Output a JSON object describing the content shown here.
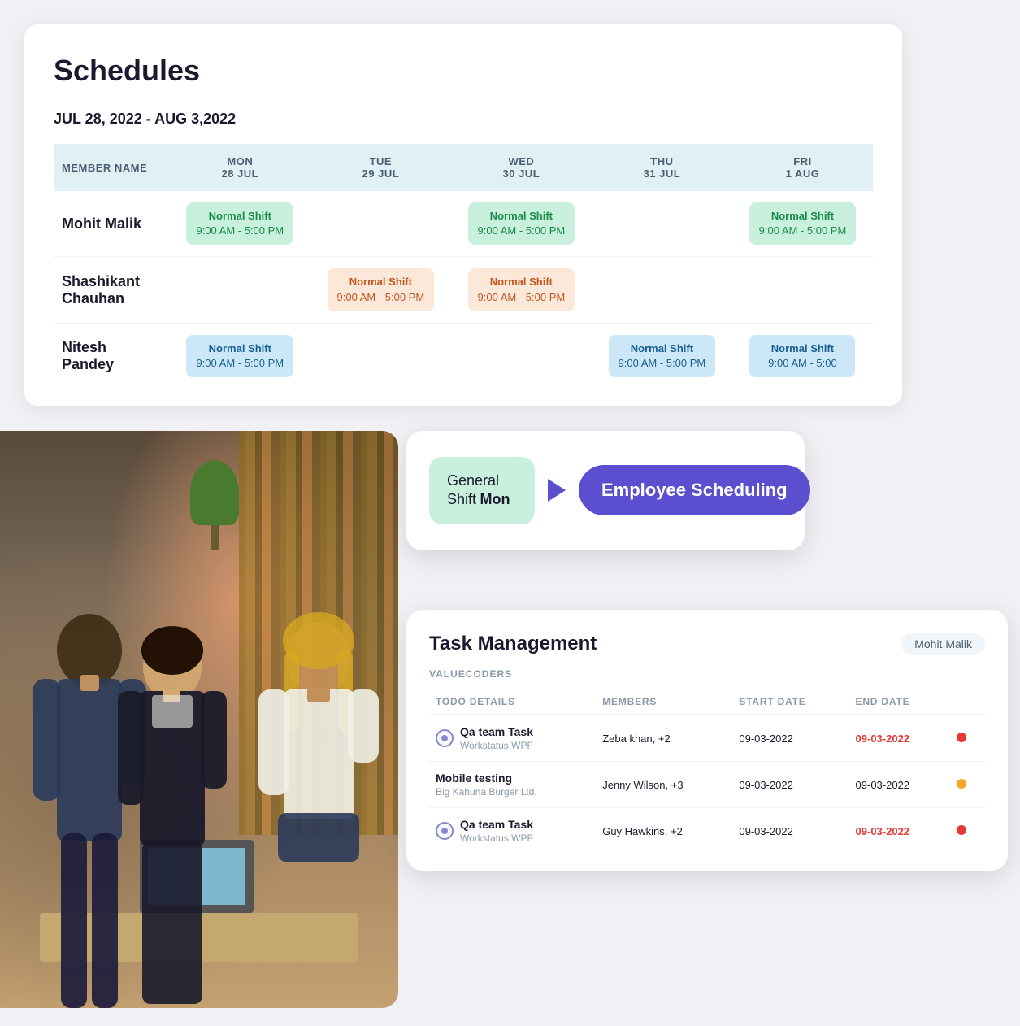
{
  "page": {
    "background": "#f0f0f5"
  },
  "schedules": {
    "title": "Schedules",
    "date_range": "JUL 28, 2022 - AUG 3,2022",
    "columns": [
      {
        "id": "name",
        "label": "MEMBER NAME",
        "sub": ""
      },
      {
        "id": "mon",
        "label": "MON",
        "sub": "28 JUL"
      },
      {
        "id": "tue",
        "label": "TUE",
        "sub": "29 JUL"
      },
      {
        "id": "wed",
        "label": "WED",
        "sub": "30 JUL"
      },
      {
        "id": "thu",
        "label": "THU",
        "sub": "31 JUL"
      },
      {
        "id": "fri",
        "label": "FRI",
        "sub": "1 AUG"
      }
    ],
    "rows": [
      {
        "name": "Mohit Malik",
        "shifts": {
          "mon": {
            "label": "Normal Shift",
            "time": "9:00 AM - 5:00 PM",
            "type": "green"
          },
          "tue": null,
          "wed": {
            "label": "Normal Shift",
            "time": "9:00 AM - 5:00 PM",
            "type": "green"
          },
          "thu": null,
          "fri": {
            "label": "Normal Shift",
            "time": "9:00 AM - 5:00 PM",
            "type": "green"
          }
        }
      },
      {
        "name": "Shashikant Chauhan",
        "shifts": {
          "mon": null,
          "tue": {
            "label": "Normal Shift",
            "time": "9:00 AM - 5:00 PM",
            "type": "peach"
          },
          "wed": {
            "label": "Normal Shift",
            "time": "9:00 AM - 5:00 PM",
            "type": "peach"
          },
          "thu": null,
          "fri": null
        }
      },
      {
        "name": "Nitesh Pandey",
        "shifts": {
          "mon": {
            "label": "Normal Shift",
            "time": "9:00 AM - 5:00 PM",
            "type": "blue"
          },
          "tue": null,
          "wed": null,
          "thu": {
            "label": "Normal Shift",
            "time": "9:00 AM - 5:00 PM",
            "type": "blue"
          },
          "fri": {
            "label": "Normal Shift",
            "time": "9:00 AM - 5:00",
            "type": "blue"
          }
        }
      }
    ]
  },
  "emp_scheduling": {
    "general_shift_label": "General Shift",
    "general_shift_day": "Mon",
    "badge_label": "Employee Scheduling"
  },
  "task_management": {
    "title": "Task Management",
    "user_badge": "Mohit Malik",
    "org_label": "VALUECODERS",
    "columns": [
      {
        "id": "todo",
        "label": "TODO DETAILS"
      },
      {
        "id": "members",
        "label": "MEMBERS"
      },
      {
        "id": "start_date",
        "label": "START DATE"
      },
      {
        "id": "end_date",
        "label": "END DATE"
      },
      {
        "id": "status",
        "label": ""
      }
    ],
    "rows": [
      {
        "todo_name": "Qa team Task",
        "todo_org": "Workstatus WPF",
        "members": "Zeba khan, +2",
        "start_date": "09-03-2022",
        "end_date": "09-03-2022",
        "end_date_red": true,
        "status_color": "red",
        "has_icon": true
      },
      {
        "todo_name": "Mobile testing",
        "todo_org": "Big Kahuna Burger Ltd.",
        "members": "Jenny Wilson, +3",
        "start_date": "09-03-2022",
        "end_date": "09-03-2022",
        "end_date_red": false,
        "status_color": "yellow",
        "has_icon": false
      },
      {
        "todo_name": "Qa team Task",
        "todo_org": "Workstatus WPF",
        "members": "Guy Hawkins, +2",
        "start_date": "09-03-2022",
        "end_date": "09-03-2022",
        "end_date_red": true,
        "status_color": "red",
        "has_icon": true
      }
    ]
  }
}
